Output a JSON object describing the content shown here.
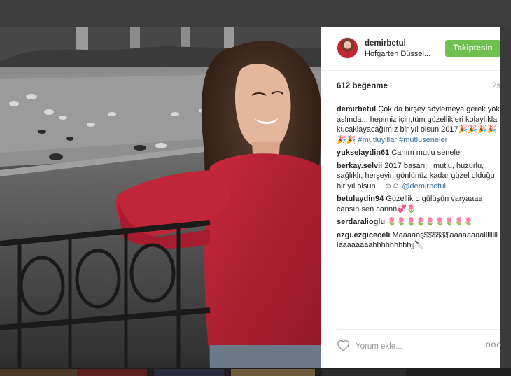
{
  "post": {
    "username": "demirbetul",
    "location": "Hofgarten Düssel...",
    "follow_label": "Takiptesin",
    "likes": "612 beğenme",
    "time_ago": "2s",
    "caption": {
      "user": "demirbetul",
      "text": "Çok da birşey söylemeye gerek yok aslında... hepimiz için;tüm güzellikleri kolaylıkla kucaklayacağımız bir yıl olsun 2017🎉🎉🎉🎉🎉🎉 ",
      "tag1": "#mutluyillar",
      "tag2": "#mutluseneler"
    }
  },
  "comments": [
    {
      "user": "yukselaydin61",
      "text": "Canım mutlu seneler."
    },
    {
      "user": "berkay.selvii",
      "text": "2017 başarılı, mutlu, huzurlu, sağlıklı, herşeyin gönlünüz kadar güzel olduğu bir yıl olsun... ☺☺ ",
      "mention": "@demirbetul"
    },
    {
      "user": "betulaydin94",
      "text": "Güzellik o gülüşün varyaaaa cansın sen cannn💞🌷"
    },
    {
      "user": "serdaralioglu",
      "text": "🌷🌷🌷🌷🌷🌷🌷🌷🌷"
    },
    {
      "user": "ezgi.ezgiceceli",
      "text": "Maaaaaş$$$$$$aaaaaaaallllllll laaaaaaaahhhhhhhhhjj🔪"
    }
  ],
  "footer": {
    "comment_placeholder": "Yorum ekle...",
    "more_label": "ooo"
  },
  "icons": {
    "heart": "heart-icon",
    "more": "more-options-icon",
    "avatar": "avatar"
  },
  "colors": {
    "follow_button": "#70c050",
    "hashtag_link": "#3f729b",
    "backdrop": "#3a3a3a"
  }
}
